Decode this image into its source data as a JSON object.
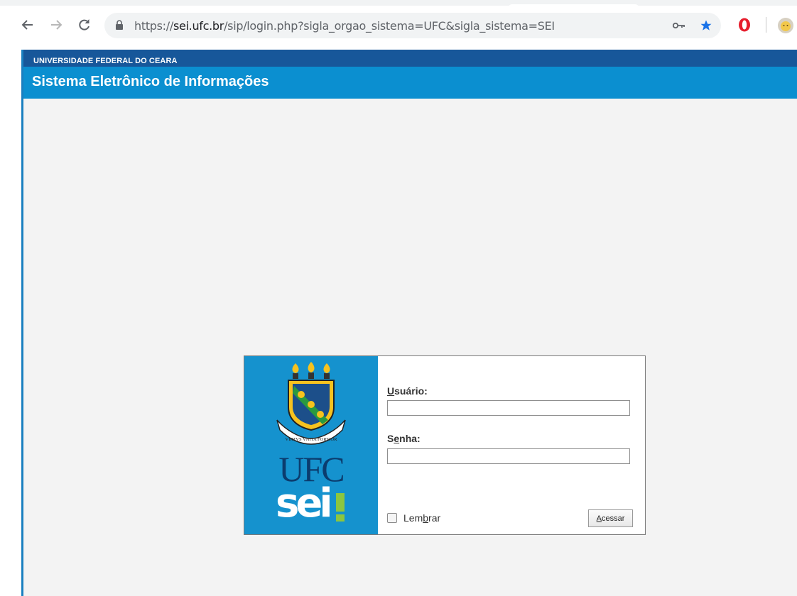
{
  "browser": {
    "url_prefix": "https://",
    "url_host": "sei.ufc.br",
    "url_path": "/sip/login.php?sigla_orgao_sistema=UFC&sigla_sistema=SEI"
  },
  "header": {
    "org_name": "UNIVERSIDADE FEDERAL DO CEARA",
    "system_name": "Sistema Eletrônico de Informações"
  },
  "login": {
    "brand_ufc": "UFC",
    "brand_sei": "sei",
    "crest_motto": "VIRTVS VNITA FORTIOR",
    "user_label_first": "U",
    "user_label_rest": "suário:",
    "user_value": "",
    "password_label_first": "S",
    "password_label_u": "e",
    "password_label_rest": "nha:",
    "password_value": "",
    "remember_pre": "Lem",
    "remember_u": "b",
    "remember_post": "rar",
    "remember_checked": false,
    "submit_first": "A",
    "submit_rest": "cessar"
  },
  "colors": {
    "header_dark": "#17579a",
    "header_blue": "#0b8fd0",
    "brand_panel": "#1592ce",
    "sei_accent": "#8cc63f"
  }
}
